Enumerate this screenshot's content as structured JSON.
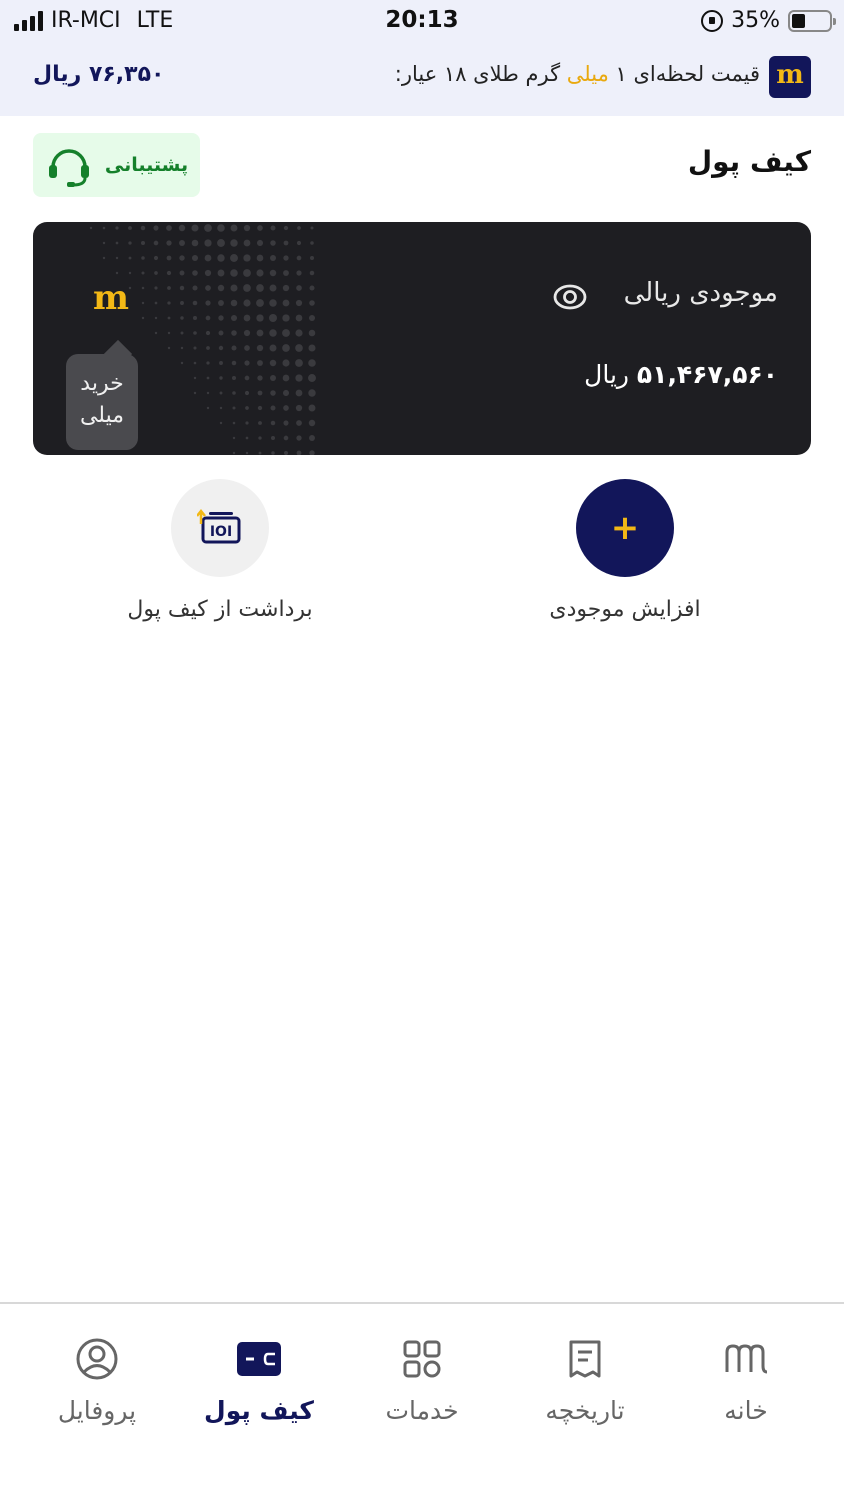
{
  "status_bar": {
    "carrier": "IR-MCI",
    "network": "LTE",
    "time": "20:13",
    "battery": "35%",
    "battery_level": 0.35
  },
  "price_strip": {
    "logo": "m",
    "text_before": "قیمت لحظه‌ای ۱ ",
    "text_highlight": "میلی",
    "text_after": " گرم طلای ۱۸ عیار:",
    "price": "۷۶,۳۵۰ ریال"
  },
  "header": {
    "title": "کیف پول",
    "support_label": "پشتیبانی"
  },
  "wallet_card": {
    "title": "موجودی ریالی",
    "balance_value": "۵۱,۴۶۷,۵۶۰",
    "balance_unit": "ریال",
    "logo": "m",
    "buy_line1": "خرید",
    "buy_line2": "میلی"
  },
  "actions": {
    "add_icon": "+",
    "add_label": "افزایش موجودی",
    "withdraw_label": "برداشت از کیف پول"
  },
  "bottom_nav": {
    "items": [
      {
        "label": "خانه",
        "icon": "home-logo-icon"
      },
      {
        "label": "تاریخچه",
        "icon": "receipt-icon"
      },
      {
        "label": "خدمات",
        "icon": "grid-icon"
      },
      {
        "label": "کیف پول",
        "icon": "wallet-icon",
        "active": true
      },
      {
        "label": "پروفایل",
        "icon": "profile-icon"
      }
    ]
  },
  "colors": {
    "brand_navy": "#12165a",
    "brand_gold": "#f2b816",
    "card_bg": "#1e1e22",
    "support_green": "#15802b"
  }
}
